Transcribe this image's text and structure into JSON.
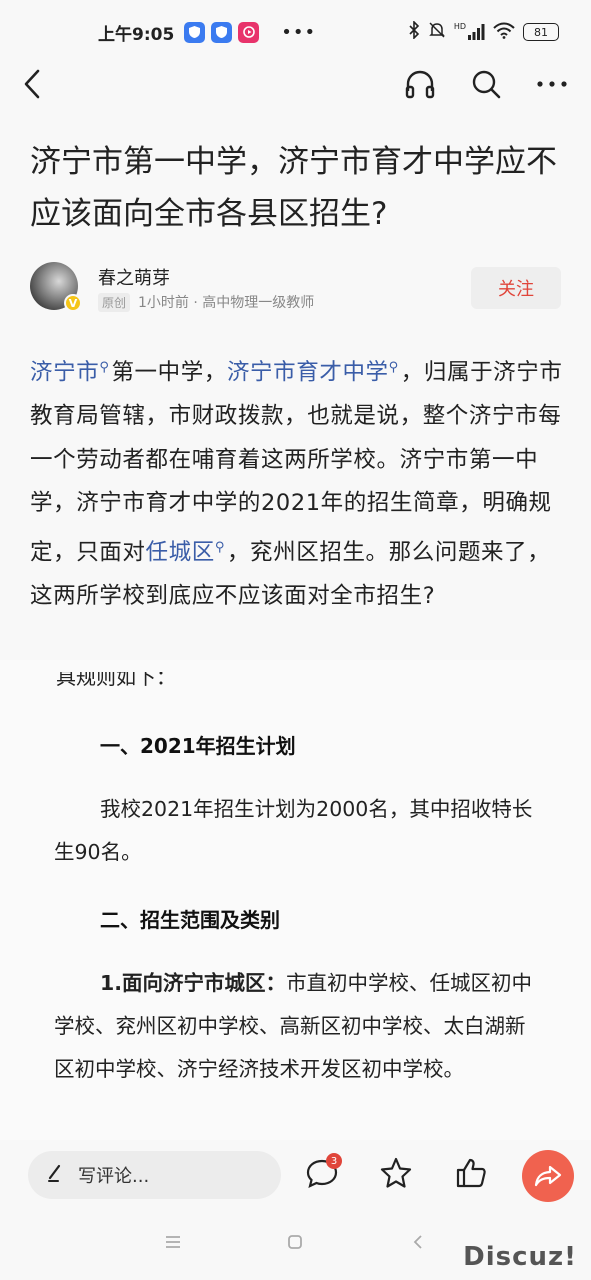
{
  "status": {
    "time": "上午9:05",
    "dots": "•••",
    "network": "HD",
    "battery": "81"
  },
  "article": {
    "title": "济宁市第一中学，济宁市育才中学应不应该面向全市各县区招生?",
    "author": {
      "name": "春之萌芽",
      "tag": "原创",
      "meta": "1小时前 · 高中物理一级教师",
      "badge": "V",
      "follow_label": "关注"
    },
    "p1": {
      "link1": "济宁市",
      "text1": "第一中学，",
      "link2": "济宁市育才中学",
      "text2": "，归属于济宁市教育局管辖，市财政拨款，也就是说，整个济宁市每一个劳动者都在哺育着这两所学校。济宁市第一中学，济宁市育才中学的2021年的招生简章，明确规定，只面对",
      "link3": "任城区",
      "text3": "，兖州区招生。那么问题来了，这两所学校到底应不应该面对全市招生?"
    }
  },
  "doc_image": {
    "cut_text": "具规则如下：",
    "h1": "一、2021年招生计划",
    "para1": "我校2021年招生计划为2000名，其中招收特长生90名。",
    "h2": "二、招生范围及类别",
    "para2_bold": "1.面向济宁市城区：",
    "para2": "市直初中学校、任城区初中学校、兖州区初中学校、高新区初中学校、太白湖新区初中学校、济宁经济技术开发区初中学校。"
  },
  "bottom": {
    "comment_placeholder": "写评论...",
    "comment_count": "3"
  },
  "watermark": "Discuz!",
  "colors": {
    "link": "#3a5da8",
    "accent": "#e0453a",
    "share": "#f0624f"
  }
}
